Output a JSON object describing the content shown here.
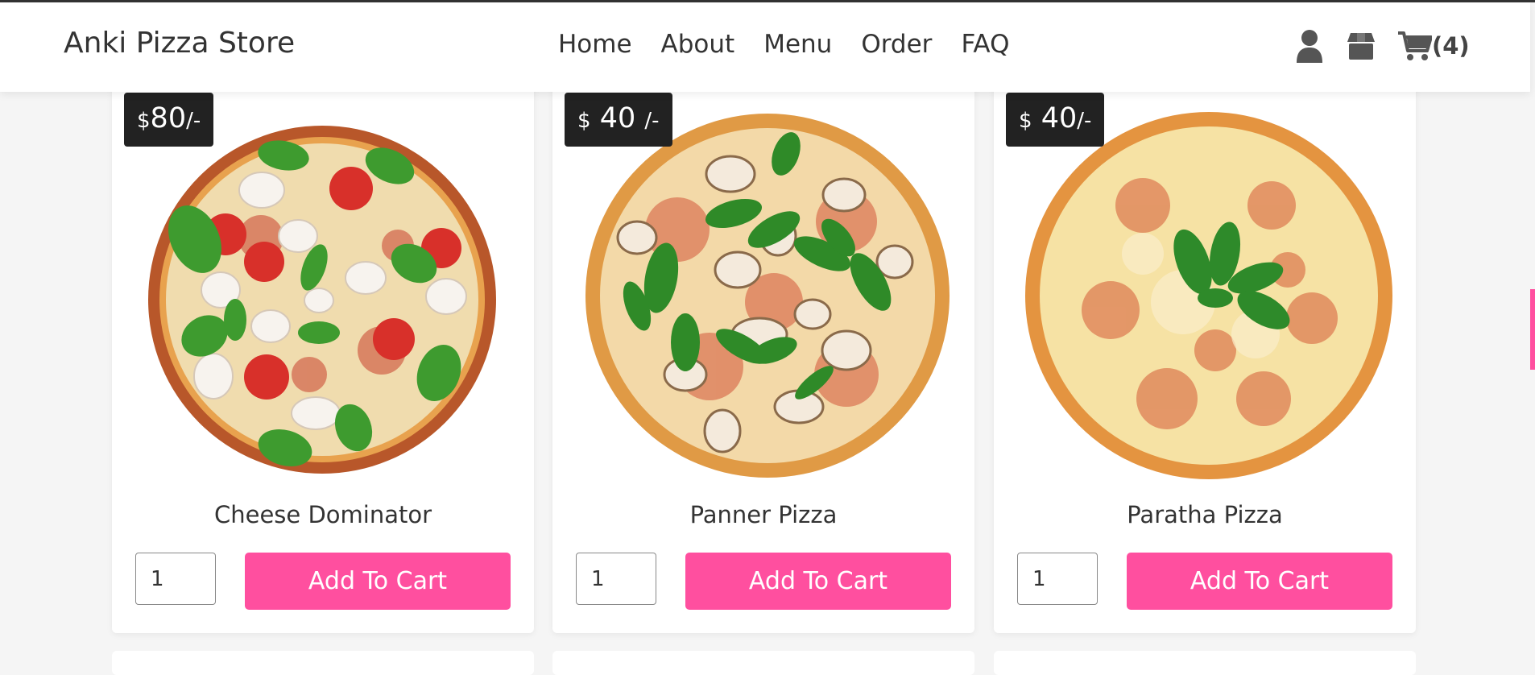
{
  "header": {
    "brand": "Anki Pizza Store",
    "nav": [
      "Home",
      "About",
      "Menu",
      "Order",
      "FAQ"
    ],
    "icons": [
      "user-icon",
      "box-icon",
      "cart-icon"
    ],
    "cart_count": "(4)"
  },
  "products": [
    {
      "currency": "$",
      "amount": "80",
      "suffix": "/-",
      "name": "Cheese Dominator",
      "qty": "1",
      "button": "Add To Cart"
    },
    {
      "currency": "$",
      "amount": "40",
      "suffix": "/-",
      "name": "Panner Pizza",
      "qty": "1",
      "button": "Add To Cart"
    },
    {
      "currency": "$",
      "amount": "40",
      "suffix": "/-",
      "name": "Paratha Pizza",
      "qty": "1",
      "button": "Add To Cart"
    }
  ],
  "colors": {
    "accent": "#ff4f9f",
    "price_badge": "#222222",
    "background": "#f5f5f5"
  }
}
